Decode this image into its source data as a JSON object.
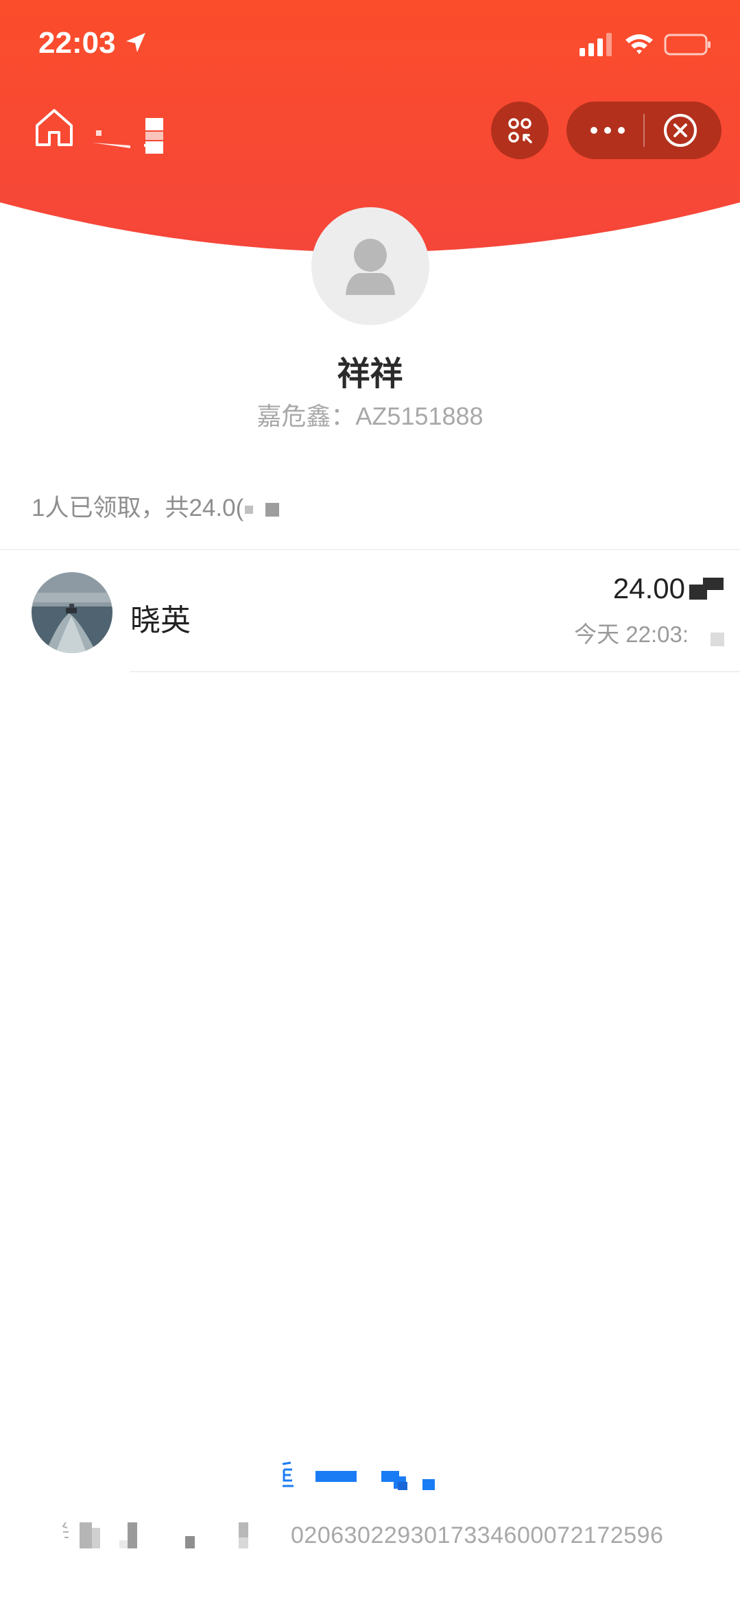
{
  "status_bar": {
    "time": "22:03"
  },
  "colors": {
    "header_red": "#f94a2e",
    "capsule_bg": "#b3301c",
    "text_dark": "#222222",
    "text_gray": "#9a9a9a",
    "link_blue": "#1a7cf5"
  },
  "sender": {
    "name": "祥祥",
    "subtitle": "嘉危鑫：AZ5151888"
  },
  "summary": {
    "text": "1人已领取，共24.0("
  },
  "records": [
    {
      "name": "晓英",
      "amount": "24.00",
      "time": "今天 22:03:"
    }
  ],
  "footer": {
    "code": "0206302293017334600072172596"
  },
  "icons": {
    "home": "home-icon",
    "scan": "scan-icon",
    "more": "more-icon",
    "close": "close-circle-icon",
    "location": "location-arrow-icon",
    "signal": "signal-icon",
    "wifi": "wifi-icon",
    "battery": "battery-icon"
  }
}
